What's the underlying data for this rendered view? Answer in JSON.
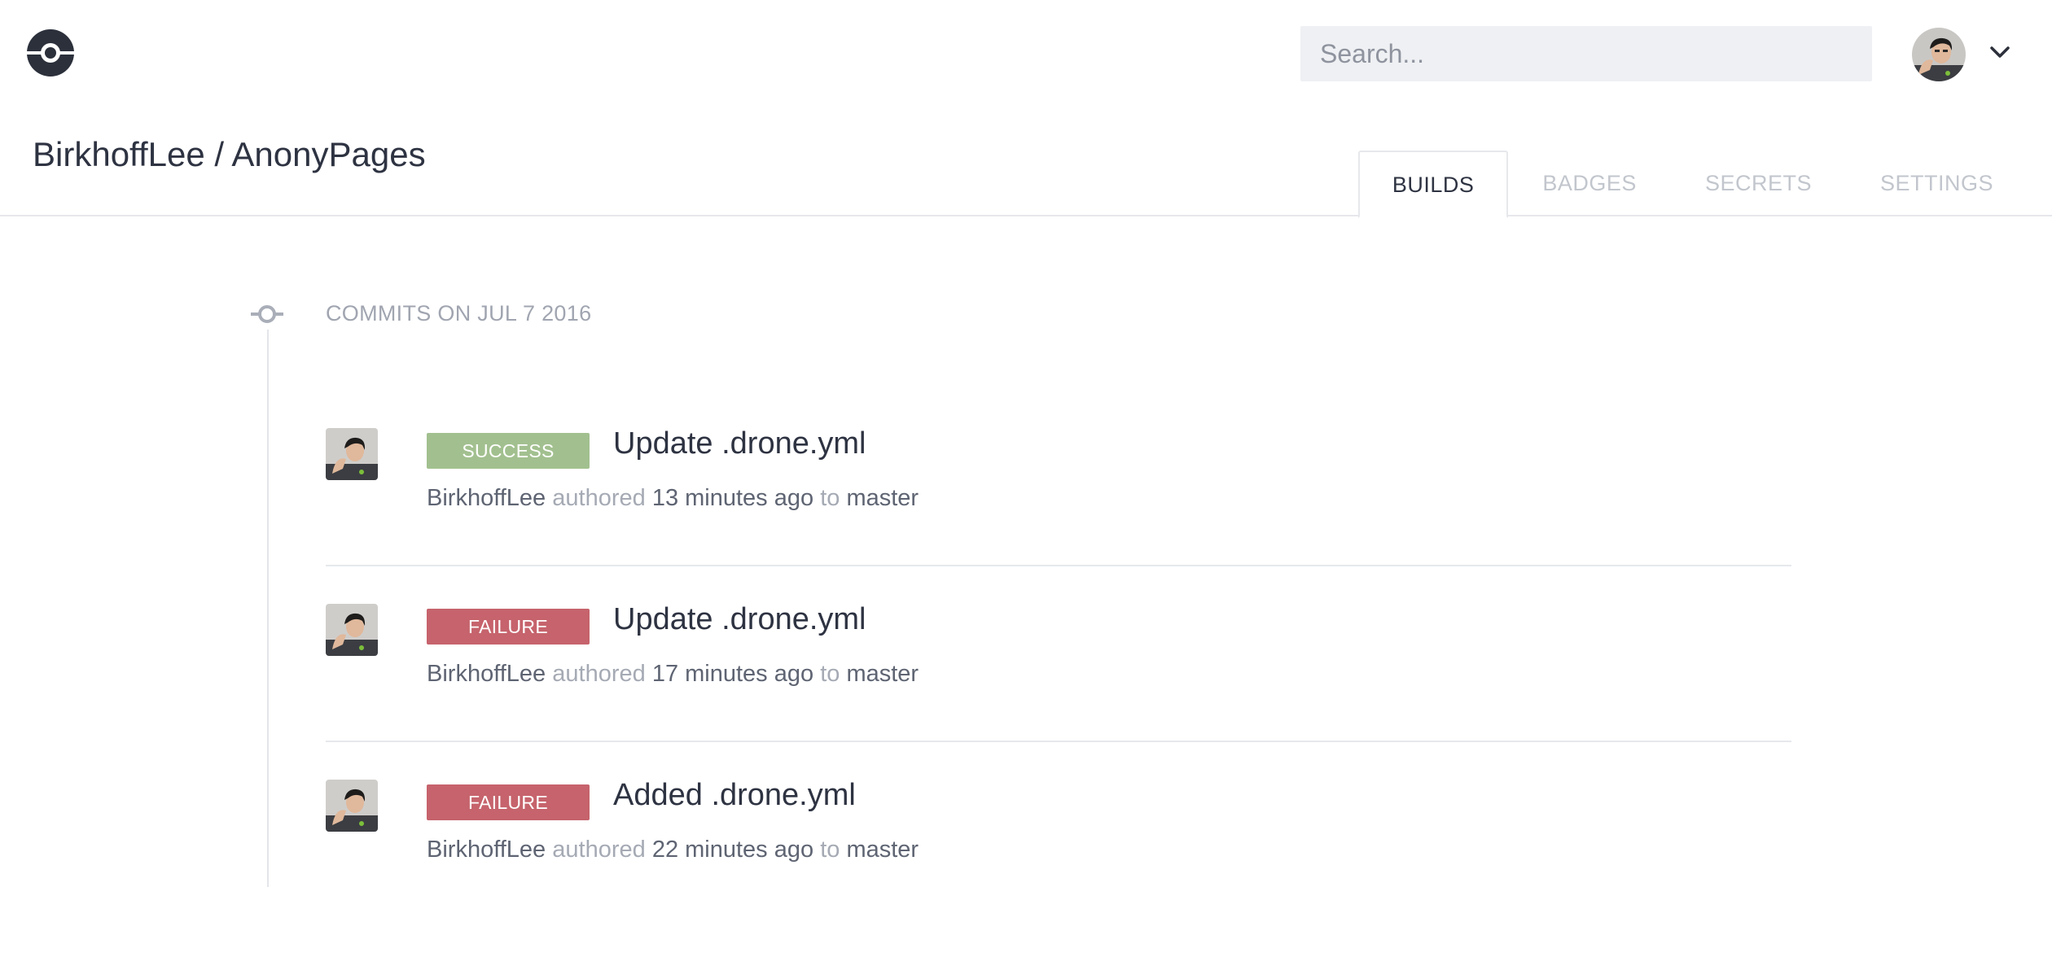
{
  "header": {
    "search_placeholder": "Search...",
    "logo_icon": "drone-logo-icon",
    "caret_icon": "chevron-down-icon"
  },
  "repo": {
    "owner": "BirkhoffLee",
    "separator": "/",
    "name": "AnonyPages"
  },
  "tabs": [
    {
      "label": "BUILDS",
      "active": true
    },
    {
      "label": "BADGES",
      "active": false
    },
    {
      "label": "SECRETS",
      "active": false
    },
    {
      "label": "SETTINGS",
      "active": false
    }
  ],
  "timeline": {
    "date_heading": "COMMITS ON JUL 7 2016",
    "builds": [
      {
        "status": "SUCCESS",
        "title": "Update .drone.yml",
        "author": "BirkhoffLee",
        "authored_word": "authored",
        "time": "13 minutes ago",
        "to_word": "to",
        "branch": "master"
      },
      {
        "status": "FAILURE",
        "title": "Update .drone.yml",
        "author": "BirkhoffLee",
        "authored_word": "authored",
        "time": "17 minutes ago",
        "to_word": "to",
        "branch": "master"
      },
      {
        "status": "FAILURE",
        "title": "Added .drone.yml",
        "author": "BirkhoffLee",
        "authored_word": "authored",
        "time": "22 minutes ago",
        "to_word": "to",
        "branch": "master"
      }
    ]
  },
  "colors": {
    "success": "#a2c08f",
    "failure": "#c6636c",
    "text": "#2e3342",
    "muted": "#a5aab4"
  }
}
